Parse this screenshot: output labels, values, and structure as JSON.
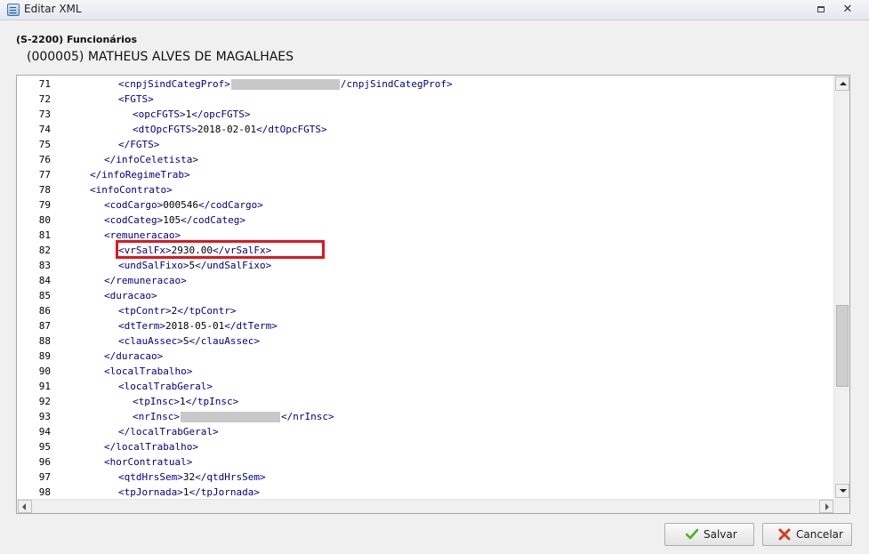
{
  "window": {
    "title": "Editar XML"
  },
  "header": {
    "event_title": "(S-2200) Funcionários",
    "employee": "(000005) MATHEUS ALVES DE MAGALHAES"
  },
  "editor": {
    "lines": [
      {
        "num": "71",
        "indent": 5,
        "parts": [
          {
            "t": "tag",
            "v": "<cnpjSindCategProf>"
          },
          {
            "t": "redact"
          },
          {
            "t": "tag",
            "v": "/cnpjSindCategProf>"
          }
        ]
      },
      {
        "num": "72",
        "indent": 5,
        "parts": [
          {
            "t": "tag",
            "v": "<FGTS>"
          }
        ]
      },
      {
        "num": "73",
        "indent": 6,
        "parts": [
          {
            "t": "tag",
            "v": "<opcFGTS>"
          },
          {
            "t": "txt",
            "v": "1"
          },
          {
            "t": "tag",
            "v": "</opcFGTS>"
          }
        ]
      },
      {
        "num": "74",
        "indent": 6,
        "parts": [
          {
            "t": "tag",
            "v": "<dtOpcFGTS>"
          },
          {
            "t": "txt",
            "v": "2018-02-01"
          },
          {
            "t": "tag",
            "v": "</dtOpcFGTS>"
          }
        ]
      },
      {
        "num": "75",
        "indent": 5,
        "parts": [
          {
            "t": "tag",
            "v": "</FGTS>"
          }
        ]
      },
      {
        "num": "76",
        "indent": 4,
        "parts": [
          {
            "t": "tag",
            "v": "</infoCeletista>"
          }
        ]
      },
      {
        "num": "77",
        "indent": 3,
        "parts": [
          {
            "t": "tag",
            "v": "</infoRegimeTrab>"
          }
        ]
      },
      {
        "num": "78",
        "indent": 3,
        "parts": [
          {
            "t": "tag",
            "v": "<infoContrato>"
          }
        ]
      },
      {
        "num": "79",
        "indent": 4,
        "parts": [
          {
            "t": "tag",
            "v": "<codCargo>"
          },
          {
            "t": "txt",
            "v": "000546"
          },
          {
            "t": "tag",
            "v": "</codCargo>"
          }
        ]
      },
      {
        "num": "80",
        "indent": 4,
        "parts": [
          {
            "t": "tag",
            "v": "<codCateg>"
          },
          {
            "t": "txt",
            "v": "105"
          },
          {
            "t": "tag",
            "v": "</codCateg>"
          }
        ]
      },
      {
        "num": "81",
        "indent": 4,
        "parts": [
          {
            "t": "tag",
            "v": "<remuneracao>"
          }
        ]
      },
      {
        "num": "82",
        "indent": 5,
        "parts": [
          {
            "t": "tag",
            "v": "<vrSalFx>"
          },
          {
            "t": "txt",
            "v": "2930.00"
          },
          {
            "t": "tag",
            "v": "</vrSalFx>"
          }
        ]
      },
      {
        "num": "83",
        "indent": 5,
        "parts": [
          {
            "t": "tag",
            "v": "<undSalFixo>"
          },
          {
            "t": "txt",
            "v": "5"
          },
          {
            "t": "tag",
            "v": "</undSalFixo>"
          }
        ]
      },
      {
        "num": "84",
        "indent": 4,
        "parts": [
          {
            "t": "tag",
            "v": "</remuneracao>"
          }
        ]
      },
      {
        "num": "85",
        "indent": 4,
        "parts": [
          {
            "t": "tag",
            "v": "<duracao>"
          }
        ]
      },
      {
        "num": "86",
        "indent": 5,
        "parts": [
          {
            "t": "tag",
            "v": "<tpContr>"
          },
          {
            "t": "txt",
            "v": "2"
          },
          {
            "t": "tag",
            "v": "</tpContr>"
          }
        ]
      },
      {
        "num": "87",
        "indent": 5,
        "parts": [
          {
            "t": "tag",
            "v": "<dtTerm>"
          },
          {
            "t": "txt",
            "v": "2018-05-01"
          },
          {
            "t": "tag",
            "v": "</dtTerm>"
          }
        ]
      },
      {
        "num": "88",
        "indent": 5,
        "parts": [
          {
            "t": "tag",
            "v": "<clauAssec>"
          },
          {
            "t": "txt",
            "v": "S"
          },
          {
            "t": "tag",
            "v": "</clauAssec>"
          }
        ]
      },
      {
        "num": "89",
        "indent": 4,
        "parts": [
          {
            "t": "tag",
            "v": "</duracao>"
          }
        ]
      },
      {
        "num": "90",
        "indent": 4,
        "parts": [
          {
            "t": "tag",
            "v": "<localTrabalho>"
          }
        ]
      },
      {
        "num": "91",
        "indent": 5,
        "parts": [
          {
            "t": "tag",
            "v": "<localTrabGeral>"
          }
        ]
      },
      {
        "num": "92",
        "indent": 6,
        "parts": [
          {
            "t": "tag",
            "v": "<tpInsc>"
          },
          {
            "t": "txt",
            "v": "1"
          },
          {
            "t": "tag",
            "v": "</tpInsc>"
          }
        ]
      },
      {
        "num": "93",
        "indent": 6,
        "parts": [
          {
            "t": "tag",
            "v": "<nrInsc>"
          },
          {
            "t": "redact2"
          },
          {
            "t": "tag",
            "v": "</nrInsc>"
          }
        ]
      },
      {
        "num": "94",
        "indent": 5,
        "parts": [
          {
            "t": "tag",
            "v": "</localTrabGeral>"
          }
        ]
      },
      {
        "num": "95",
        "indent": 4,
        "parts": [
          {
            "t": "tag",
            "v": "</localTrabalho>"
          }
        ]
      },
      {
        "num": "96",
        "indent": 4,
        "parts": [
          {
            "t": "tag",
            "v": "<horContratual>"
          }
        ]
      },
      {
        "num": "97",
        "indent": 5,
        "parts": [
          {
            "t": "tag",
            "v": "<qtdHrsSem>"
          },
          {
            "t": "txt",
            "v": "32"
          },
          {
            "t": "tag",
            "v": "</qtdHrsSem>"
          }
        ]
      },
      {
        "num": "98",
        "indent": 5,
        "parts": [
          {
            "t": "tag",
            "v": "<tpJornada>"
          },
          {
            "t": "txt",
            "v": "1"
          },
          {
            "t": "tag",
            "v": "</tpJornada>"
          }
        ]
      }
    ]
  },
  "buttons": {
    "save": "Salvar",
    "cancel": "Cancelar"
  },
  "colors": {
    "tag": "#000080",
    "highlight": "#e0161c",
    "save_icon": "#4caf2a",
    "cancel_icon": "#d93b1c"
  },
  "icons": {
    "app": "xml-document-icon",
    "restore": "restore-window-icon",
    "close": "close-icon",
    "save": "check-icon",
    "cancel": "x-icon"
  }
}
